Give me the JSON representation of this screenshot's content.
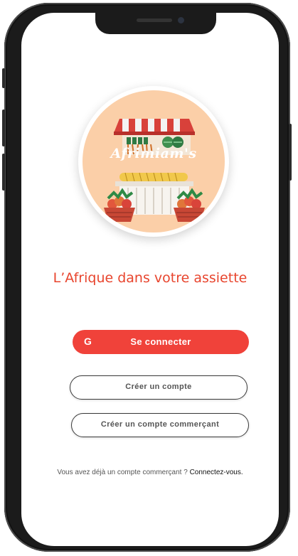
{
  "logo": {
    "brand_name": "Afrimiam's"
  },
  "tagline": "L’Afrique dans votre assiette",
  "buttons": {
    "login": {
      "icon": "google-icon",
      "icon_glyph": "G",
      "label": "Se connecter"
    },
    "create_account": "Créer un compte",
    "create_merchant_account": "Créer un compte commerçant"
  },
  "footer": {
    "prompt": "Vous avez déjà un compte  commerçant ? ",
    "link": "Connectez-vous."
  },
  "colors": {
    "accent": "#f0423a",
    "tagline": "#e8452e",
    "logo_background": "#fbcfa8"
  }
}
